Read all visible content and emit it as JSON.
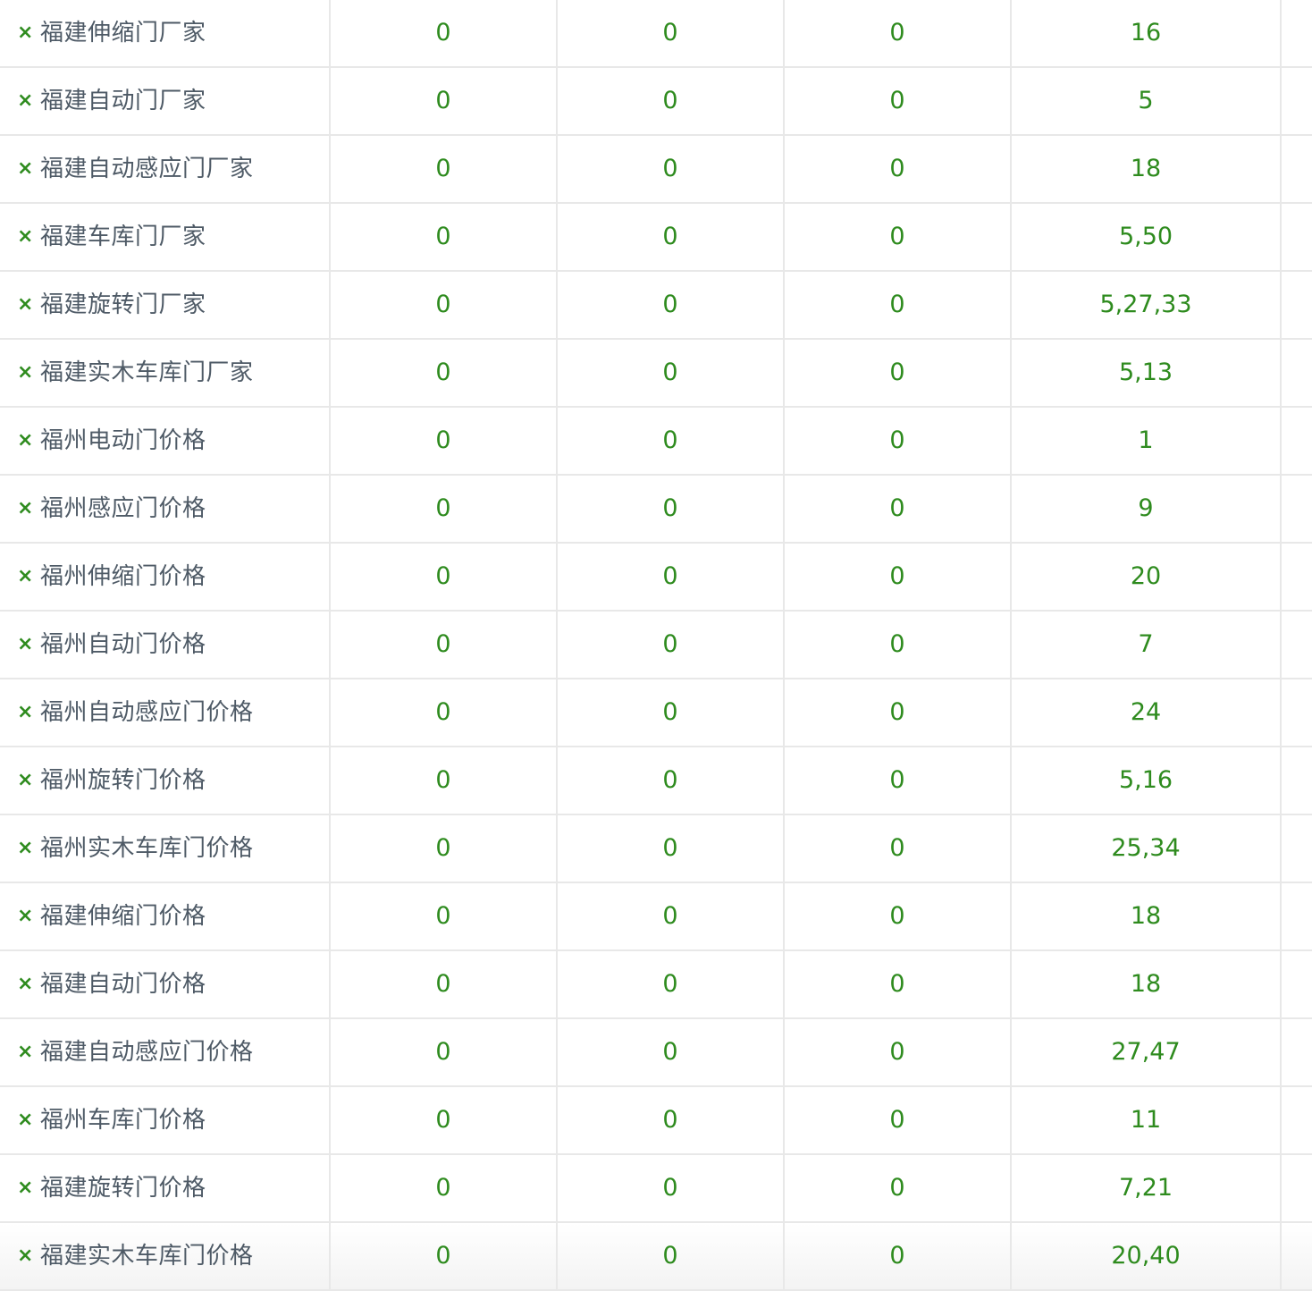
{
  "table": {
    "remove_icon_glyph": "×",
    "text_color": "#4e5a66",
    "value_color": "#2e8b1e",
    "rows": [
      {
        "keyword": "福建伸缩门厂家",
        "v1": "0",
        "v2": "0",
        "v3": "0",
        "rank": "16"
      },
      {
        "keyword": "福建自动门厂家",
        "v1": "0",
        "v2": "0",
        "v3": "0",
        "rank": "5"
      },
      {
        "keyword": "福建自动感应门厂家",
        "v1": "0",
        "v2": "0",
        "v3": "0",
        "rank": "18"
      },
      {
        "keyword": "福建车库门厂家",
        "v1": "0",
        "v2": "0",
        "v3": "0",
        "rank": "5,50"
      },
      {
        "keyword": "福建旋转门厂家",
        "v1": "0",
        "v2": "0",
        "v3": "0",
        "rank": "5,27,33"
      },
      {
        "keyword": "福建实木车库门厂家",
        "v1": "0",
        "v2": "0",
        "v3": "0",
        "rank": "5,13"
      },
      {
        "keyword": "福州电动门价格",
        "v1": "0",
        "v2": "0",
        "v3": "0",
        "rank": "1"
      },
      {
        "keyword": "福州感应门价格",
        "v1": "0",
        "v2": "0",
        "v3": "0",
        "rank": "9"
      },
      {
        "keyword": "福州伸缩门价格",
        "v1": "0",
        "v2": "0",
        "v3": "0",
        "rank": "20"
      },
      {
        "keyword": "福州自动门价格",
        "v1": "0",
        "v2": "0",
        "v3": "0",
        "rank": "7"
      },
      {
        "keyword": "福州自动感应门价格",
        "v1": "0",
        "v2": "0",
        "v3": "0",
        "rank": "24"
      },
      {
        "keyword": "福州旋转门价格",
        "v1": "0",
        "v2": "0",
        "v3": "0",
        "rank": "5,16"
      },
      {
        "keyword": "福州实木车库门价格",
        "v1": "0",
        "v2": "0",
        "v3": "0",
        "rank": "25,34"
      },
      {
        "keyword": "福建伸缩门价格",
        "v1": "0",
        "v2": "0",
        "v3": "0",
        "rank": "18"
      },
      {
        "keyword": "福建自动门价格",
        "v1": "0",
        "v2": "0",
        "v3": "0",
        "rank": "18"
      },
      {
        "keyword": "福建自动感应门价格",
        "v1": "0",
        "v2": "0",
        "v3": "0",
        "rank": "27,47"
      },
      {
        "keyword": "福州车库门价格",
        "v1": "0",
        "v2": "0",
        "v3": "0",
        "rank": "11"
      },
      {
        "keyword": "福建旋转门价格",
        "v1": "0",
        "v2": "0",
        "v3": "0",
        "rank": "7,21"
      },
      {
        "keyword": "福建实木车库门价格",
        "v1": "0",
        "v2": "0",
        "v3": "0",
        "rank": "20,40"
      }
    ]
  }
}
